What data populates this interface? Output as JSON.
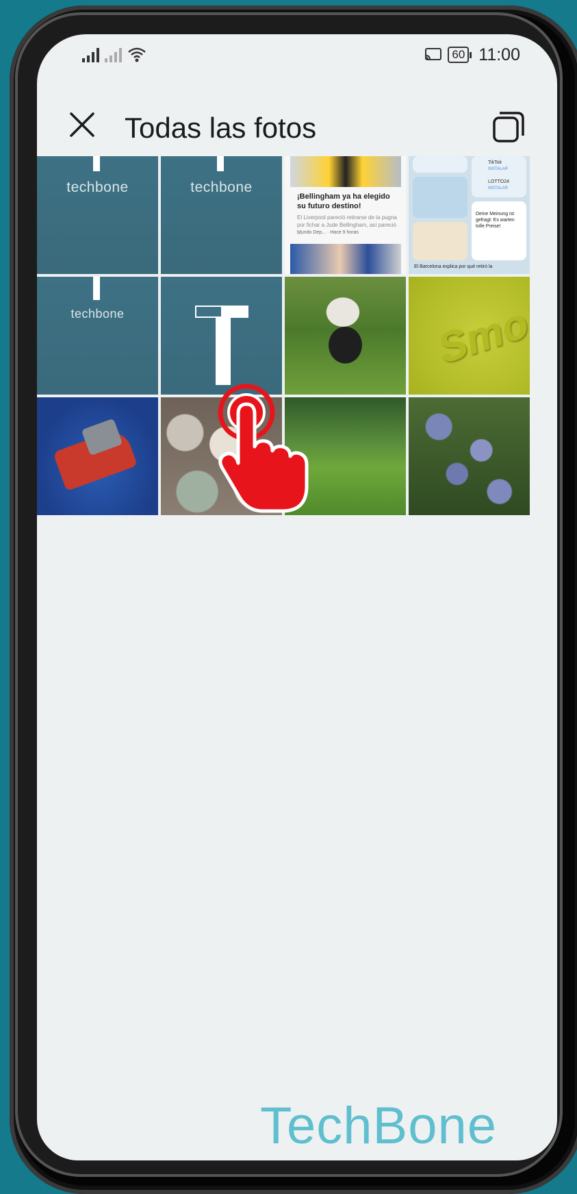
{
  "status_bar": {
    "battery": "60",
    "time": "11:00"
  },
  "header": {
    "title": "Todas las fotos"
  },
  "grid": {
    "tiles": [
      {
        "name": "techbone-tile-1",
        "text": "techbone"
      },
      {
        "name": "techbone-tile-2",
        "text": "techbone"
      },
      {
        "name": "news-tile",
        "headline": "¡Bellingham ya ha elegido su futuro destino!",
        "snippet": "El Liverpool pareció retirarse de la pugna por fichar a Jude Bellingham, así pareció ...",
        "source": "Mundo Dep... · Hace 9 horas"
      },
      {
        "name": "widget-tile",
        "labels": [
          "TikTok",
          "INSTALAR",
          "LOTTO24",
          "INSTALAR",
          "Deine Meinung ist gefragt: Es warten tolle Preise!",
          "El Barcelona explica por qué retiró la"
        ]
      },
      {
        "name": "techbone-tile-3",
        "text": "techbone"
      },
      {
        "name": "t-logo-tile"
      },
      {
        "name": "panda-photo"
      },
      {
        "name": "smoby-photo",
        "text": "Smoby"
      },
      {
        "name": "toy-car-photo"
      },
      {
        "name": "stones-photo"
      },
      {
        "name": "lawn-photo"
      },
      {
        "name": "plums-photo"
      }
    ]
  },
  "watermark": "TechBone",
  "colors": {
    "background": "#147a8c",
    "screen": "#eef1f2",
    "tap_indicator": "#e8141b",
    "watermark": "#5fbfcf"
  }
}
